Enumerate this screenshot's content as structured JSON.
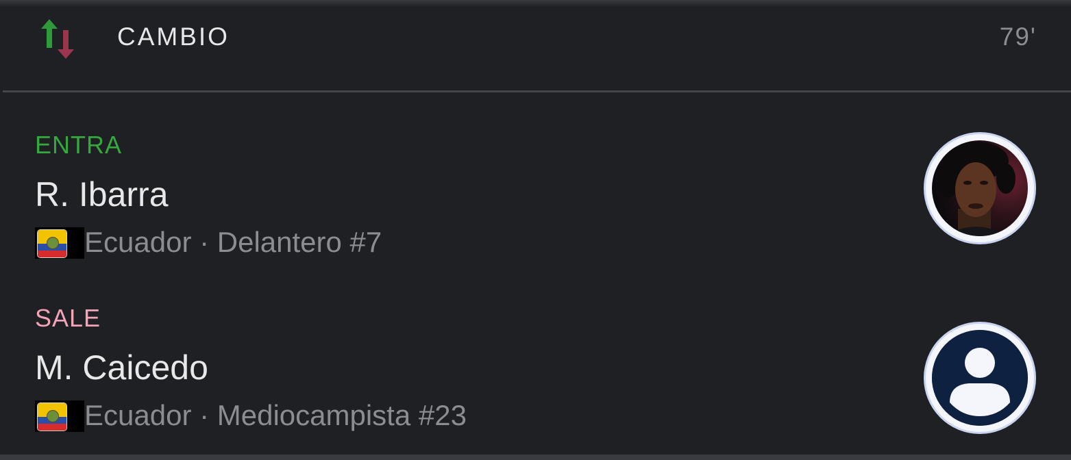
{
  "header": {
    "title": "CAMBIO",
    "minute": "79'",
    "icon": "substitution-arrows-icon",
    "colors": {
      "up_arrow": "#2f9a3a",
      "down_arrow": "#9b3550"
    }
  },
  "players": [
    {
      "role": "ENTRA",
      "name": "R. Ibarra",
      "meta": "Ecuador · Delantero #7",
      "flag": "ecuador-flag-icon",
      "avatar": "player-photo",
      "role_color": "#35a83e"
    },
    {
      "role": "SALE",
      "name": "M. Caicedo",
      "meta": "Ecuador · Mediocampista #23",
      "flag": "ecuador-flag-icon",
      "avatar": "default-user-icon",
      "role_color": "#f3a4b6"
    }
  ]
}
